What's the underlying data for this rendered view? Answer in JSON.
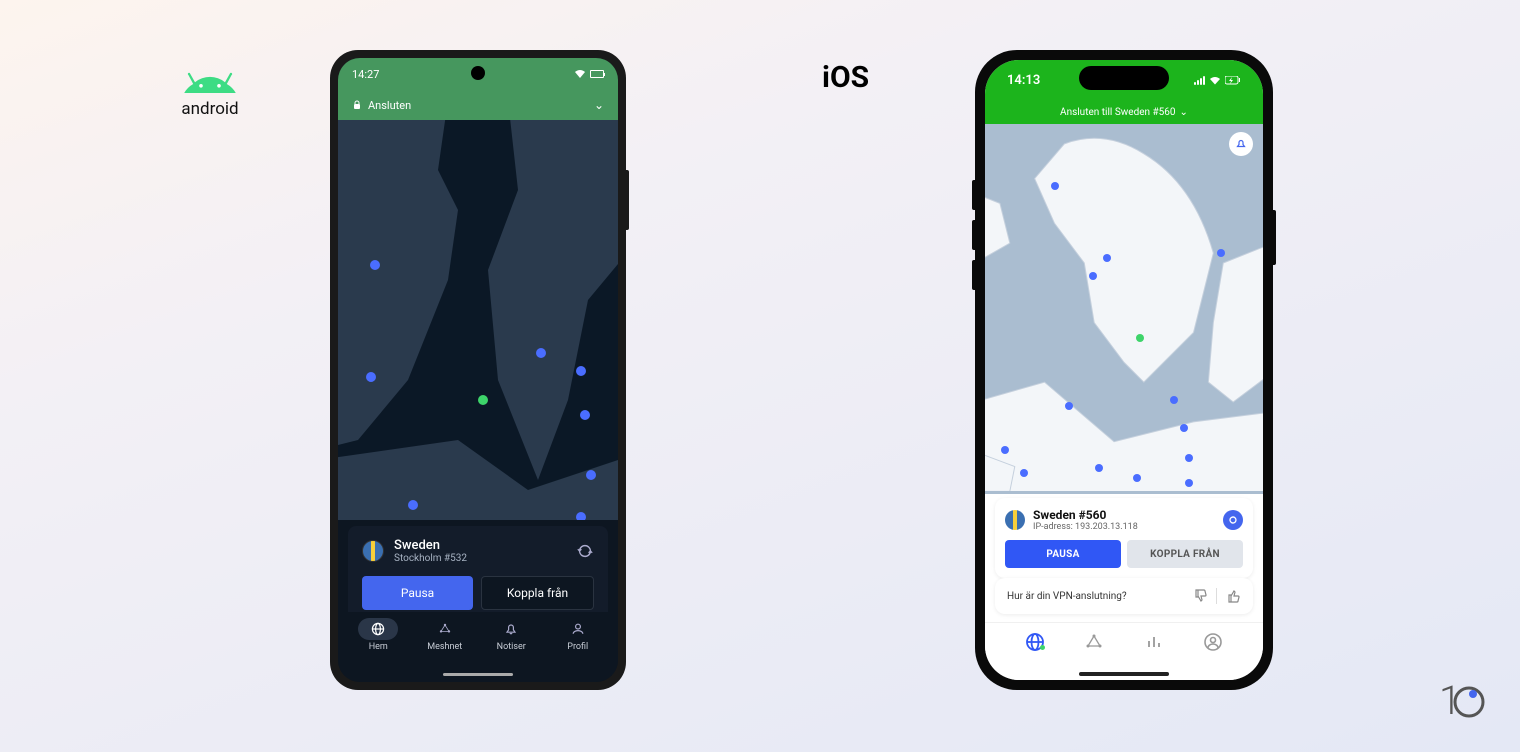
{
  "platform_labels": {
    "android": "android",
    "ios": "iOS"
  },
  "android": {
    "statusbar": {
      "time": "14:27"
    },
    "connection_bar": {
      "status": "Ansluten"
    },
    "card": {
      "country": "Sweden",
      "server": "Stockholm #532",
      "pause_label": "Pausa",
      "disconnect_label": "Koppla från"
    },
    "nav": {
      "home": "Hem",
      "meshnet": "Meshnet",
      "notifications": "Notiser",
      "profile": "Profil"
    }
  },
  "ios": {
    "statusbar": {
      "time": "14:13"
    },
    "connection_bar": {
      "status": "Ansluten till Sweden #560"
    },
    "card": {
      "country": "Sweden #560",
      "ip_label": "IP-adress: 193.203.13.118",
      "pause_label": "PAUSA",
      "disconnect_label": "KOPPLA FRÅN"
    },
    "feedback": {
      "prompt": "Hur är din VPN-anslutning?"
    }
  }
}
